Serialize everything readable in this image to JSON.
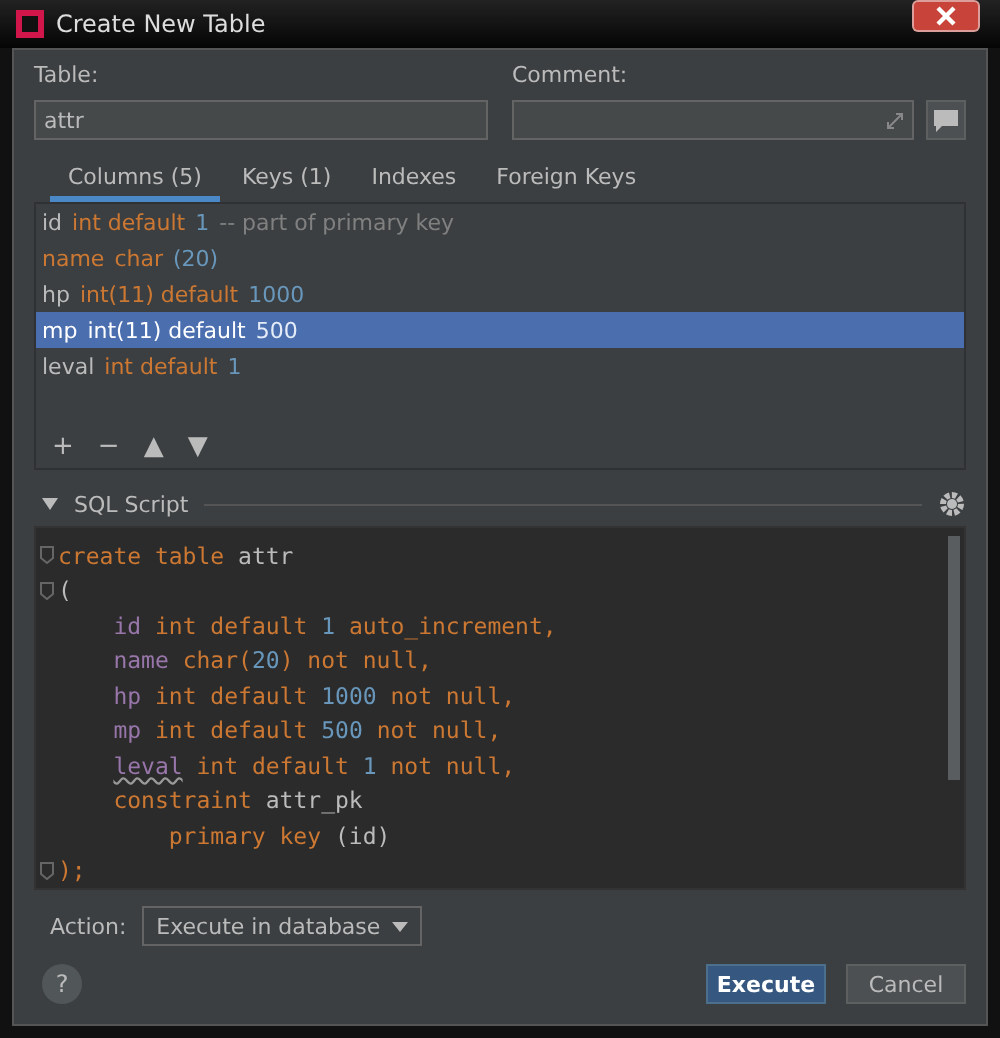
{
  "window": {
    "title": "Create New Table"
  },
  "table_field": {
    "label": "Table:",
    "value": "attr"
  },
  "comment_field": {
    "label": "Comment:"
  },
  "tabs": [
    {
      "label": "Columns (5)",
      "selected": true
    },
    {
      "label": "Keys (1)",
      "selected": false
    },
    {
      "label": "Indexes",
      "selected": false
    },
    {
      "label": "Foreign Keys",
      "selected": false
    }
  ],
  "columns": [
    {
      "selected": false,
      "parts": [
        {
          "text": "id",
          "kind": "plain"
        },
        {
          "text": "int default",
          "kind": "keyword"
        },
        {
          "text": "1",
          "kind": "number"
        },
        {
          "text": "-- part of primary key",
          "kind": "comment"
        }
      ]
    },
    {
      "selected": false,
      "parts": [
        {
          "text": "name",
          "kind": "keyword"
        },
        {
          "text": "char",
          "kind": "keyword"
        },
        {
          "text": "(20)",
          "kind": "number"
        }
      ]
    },
    {
      "selected": false,
      "parts": [
        {
          "text": "hp",
          "kind": "plain"
        },
        {
          "text": "int(11) default",
          "kind": "keyword"
        },
        {
          "text": "1000",
          "kind": "number"
        }
      ]
    },
    {
      "selected": true,
      "parts": [
        {
          "text": "mp",
          "kind": "plain"
        },
        {
          "text": "int(11) default",
          "kind": "keyword"
        },
        {
          "text": "500",
          "kind": "number"
        }
      ]
    },
    {
      "selected": false,
      "parts": [
        {
          "text": "leval",
          "kind": "plain"
        },
        {
          "text": "int default",
          "kind": "keyword"
        },
        {
          "text": "1",
          "kind": "number"
        }
      ]
    }
  ],
  "toolbar": [
    "+",
    "−",
    "▲",
    "▼"
  ],
  "sql_section": {
    "title": "SQL Script",
    "expanded": true
  },
  "sql_lines": [
    {
      "tokens": [
        {
          "text": "create table",
          "kind": "keyword"
        },
        {
          "text": "attr",
          "kind": "plain"
        }
      ]
    },
    {
      "tokens": [
        {
          "text": "(",
          "kind": "plain"
        }
      ],
      "children": [
        {
          "tokens": [
            {
              "text": "id",
              "kind": "column"
            },
            {
              "text": "int default",
              "kind": "keyword"
            },
            {
              "text": "1",
              "kind": "number"
            },
            {
              "text": "auto_increment,",
              "kind": "keyword"
            }
          ]
        },
        {
          "tokens": [
            {
              "text": "name",
              "kind": "column"
            },
            {
              "text": "char(",
              "kind": "keyword"
            },
            {
              "text": "20",
              "kind": "number"
            },
            {
              "text": ") not null,",
              "kind": "keyword"
            }
          ]
        },
        {
          "tokens": [
            {
              "text": "hp",
              "kind": "column"
            },
            {
              "text": "int default",
              "kind": "keyword"
            },
            {
              "text": "1000",
              "kind": "number"
            },
            {
              "text": "not null,",
              "kind": "keyword"
            }
          ]
        },
        {
          "tokens": [
            {
              "text": "mp",
              "kind": "column"
            },
            {
              "text": "int default",
              "kind": "keyword"
            },
            {
              "text": "500",
              "kind": "number"
            },
            {
              "text": "not null,",
              "kind": "keyword"
            }
          ]
        },
        {
          "tokens": [
            {
              "text": "leval",
              "kind": "warn"
            },
            {
              "text": "int default",
              "kind": "keyword"
            },
            {
              "text": "1",
              "kind": "number"
            },
            {
              "text": "not null,",
              "kind": "keyword"
            }
          ]
        },
        {
          "tokens": [
            {
              "text": "constraint",
              "kind": "keyword"
            },
            {
              "text": "attr_pk",
              "kind": "plain"
            }
          ],
          "children": [
            {
              "tokens": [
                {
                  "text": "primary key",
                  "kind": "keyword"
                },
                {
                  "text": "(id)",
                  "kind": "plain"
                }
              ]
            }
          ]
        }
      ]
    },
    {
      "tokens": [
        {
          "text": ");",
          "kind": "keyword"
        }
      ]
    }
  ],
  "action": {
    "label": "Action:",
    "value": "Execute in database"
  },
  "help": "?",
  "buttons": [
    {
      "label": "Execute",
      "kind": "primary"
    },
    {
      "label": "Cancel",
      "kind": "secondary"
    }
  ]
}
